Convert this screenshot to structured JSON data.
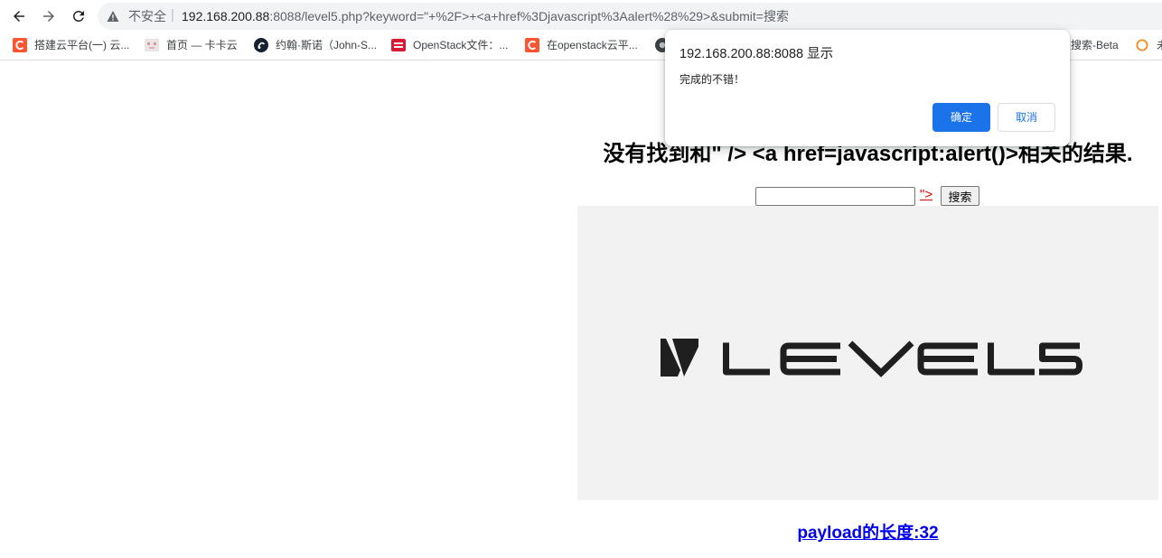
{
  "browser": {
    "nav": {
      "back_icon": "arrow-left-icon",
      "forward_icon": "arrow-right-icon",
      "reload_icon": "reload-icon"
    },
    "address_bar": {
      "security_icon": "warning-icon",
      "security_label": "不安全",
      "separator": "|",
      "url_host": "192.168.200.88",
      "url_rest": ":8088/level5.php?keyword=\"+%2F>+<a+href%3Djavascript%3Aalert%28%29>&submit=搜索"
    },
    "bookmarks": [
      {
        "label": "搭建云平台(一) 云...",
        "icon": "csdn-icon"
      },
      {
        "label": "首页 — 卡卡云",
        "icon": "kakayun-icon"
      },
      {
        "label": "约翰·斯诺（John-S...",
        "icon": "john-snow-icon"
      },
      {
        "label": "OpenStack文件：...",
        "icon": "openstack-icon"
      },
      {
        "label": "在openstack云平...",
        "icon": "csdn-icon"
      },
      {
        "icon": "globe-icon"
      },
      {
        "label": "搜索-Beta"
      },
      {
        "label": "未",
        "icon": "circle-icon"
      }
    ]
  },
  "dialog": {
    "title": "192.168.200.88:8088 显示",
    "message": "完成的不错！",
    "ok_label": "确定",
    "cancel_label": "取消"
  },
  "page": {
    "heading": "没有找到和\" /> <a href=javascript:alert()>相关的结果.",
    "search": {
      "value": "",
      "injected_link": "\">",
      "submit_label": "搜索"
    },
    "banner": {
      "logo_text": "LEVEL5",
      "logo_icon": "level5-mark-icon"
    },
    "payload_label": "payload的长度:32"
  },
  "colors": {
    "accent": "#1a73e8",
    "link": "#0000ee",
    "injected_link": "#e00000",
    "banner_bg": "#f2f2f2",
    "logo": "#1f1f1f"
  }
}
